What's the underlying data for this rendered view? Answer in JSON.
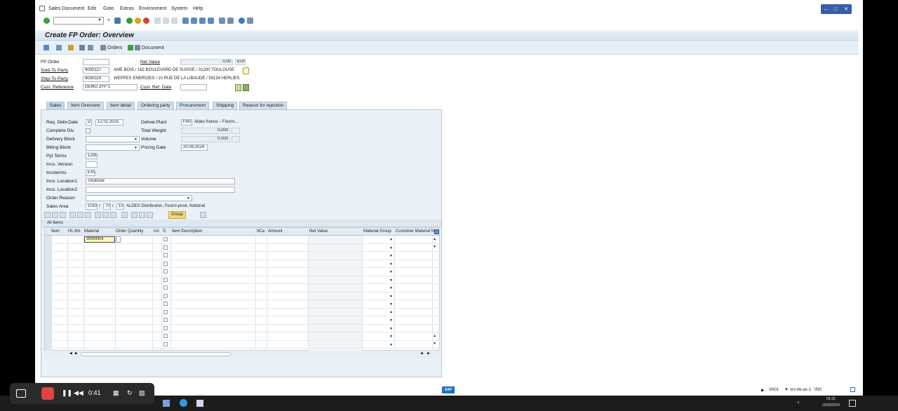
{
  "menu": [
    "Sales Document",
    "Edit",
    "Goto",
    "Extras",
    "Environment",
    "System",
    "Help"
  ],
  "title": "Create FP Order: Overview",
  "app_toolbar": {
    "orders": "Orders",
    "document": "Document"
  },
  "header": {
    "fp_order_label": "FP Order",
    "net_value_label": "Net Value",
    "net_value": "0,00",
    "currency": "EUR",
    "sold_to_label": "Sold-To Party",
    "sold_to_value": "4000127",
    "sold_to_desc": "AME BOIS / 162 BOULEVARD DE SUISSE / 31200 TOULOUSE",
    "ship_to_label": "Ship-To Party",
    "ship_to_value": "4030114",
    "ship_to_desc": "WEPPES ENERGIES / 10 RUE DE LA LIBAUDE / 59134 HERLIES",
    "cust_ref_label": "Cust. Reference",
    "cust_ref_value": "DEMO ZFP 1",
    "cust_ref_date_label": "Cust. Ref. Date"
  },
  "tabs": [
    "Sales",
    "Item Overview",
    "Item detail",
    "Ordering party",
    "Procurement",
    "Shipping",
    "Reason for rejection"
  ],
  "sales": {
    "req_deliv_label": "Req. Deliv.Date",
    "req_deliv_unit": "D",
    "req_deliv_date": "12.02.2025",
    "deliver_plant_label": "Deliver.Plant",
    "deliver_plant_code": "FR03",
    "deliver_plant_desc": "Aldes france – Fourni...",
    "complete_dlv_label": "Complete Dlv.",
    "total_weight_label": "Total Weight",
    "total_weight": "0,000",
    "delivery_block_label": "Delivery Block",
    "volume_label": "Volume",
    "volume": "0,000",
    "billing_block_label": "Billing Block",
    "pricing_date_label": "Pricing Date",
    "pricing_date": "20.09.2024",
    "pyt_terms_label": "Pyt Terms",
    "pyt_terms": "120E",
    "inco_version_label": "Inco. Version",
    "incoterms_label": "Incoterms",
    "incoterms": "EXW",
    "inco_loc1_label": "Inco. Location1",
    "inco_loc1": "Toulouse",
    "inco_loc2_label": "Inco. Location2",
    "order_reason_label": "Order Reason",
    "sales_area_label": "Sales Area",
    "sales_area_org": "1010",
    "sales_area_dc": "70",
    "sales_area_div": "10",
    "sales_area_desc": "ALDES Distribution, Fourni-posé, National"
  },
  "grid": {
    "group_label": "Group",
    "all_items_label": "All Items",
    "columns": [
      "Item",
      "HL Itm",
      "Material",
      "Order Quantity",
      "Un",
      "S",
      "Item Description",
      "ItCa",
      "Amount",
      "Net Value",
      "Material Group",
      "Customer Material N"
    ],
    "first_material": "35900004"
  },
  "status": {
    "tcode": "VA01",
    "server": "srv-ite-as-1",
    "mode": "INS",
    "time": "09:33",
    "date": "20/09/2024"
  },
  "recorder": {
    "time": "0:41"
  },
  "colors": {
    "title_bg": "#dce8f2",
    "panel_bg": "#eaf2f8",
    "group_btn": "#f4d87a"
  }
}
